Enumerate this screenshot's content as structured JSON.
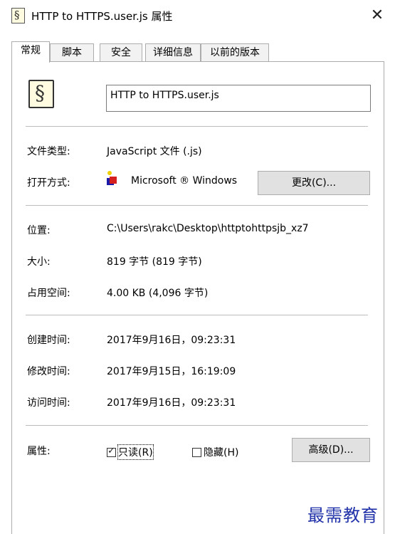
{
  "window": {
    "title": "HTTP to HTTPS.user.js 属性",
    "close_glyph": "✕"
  },
  "tabs": [
    {
      "label": "常规",
      "active": true
    },
    {
      "label": "脚本"
    },
    {
      "label": "安全"
    },
    {
      "label": "详细信息"
    },
    {
      "label": "以前的版本"
    }
  ],
  "file": {
    "name": "HTTP to HTTPS.user.js",
    "icon": "userscript-file-icon"
  },
  "general": {
    "type_label": "文件类型:",
    "type_value": "JavaScript 文件 (.js)",
    "opens_with_label": "打开方式:",
    "opens_with_value": "Microsoft ® Windows",
    "change_button": "更改(C)...",
    "location_label": "位置:",
    "location_value": "C:\\Users\\rakc\\Desktop\\httptohttpsjb_xz7",
    "size_label": "大小:",
    "size_value": "819 字节 (819 字节)",
    "size_on_disk_label": "占用空间:",
    "size_on_disk_value": "4.00 KB (4,096 字节)",
    "created_label": "创建时间:",
    "created_value": "2017年9月16日，09:23:31",
    "modified_label": "修改时间:",
    "modified_value": "2017年9月15日，16:19:09",
    "accessed_label": "访问时间:",
    "accessed_value": "2017年9月16日，09:23:31",
    "attributes_label": "属性:",
    "readonly_label": "只读(R)",
    "readonly_checked": true,
    "hidden_label": "隐藏(H)",
    "hidden_checked": false,
    "advanced_button": "高级(D)..."
  },
  "watermark": "最需教育"
}
